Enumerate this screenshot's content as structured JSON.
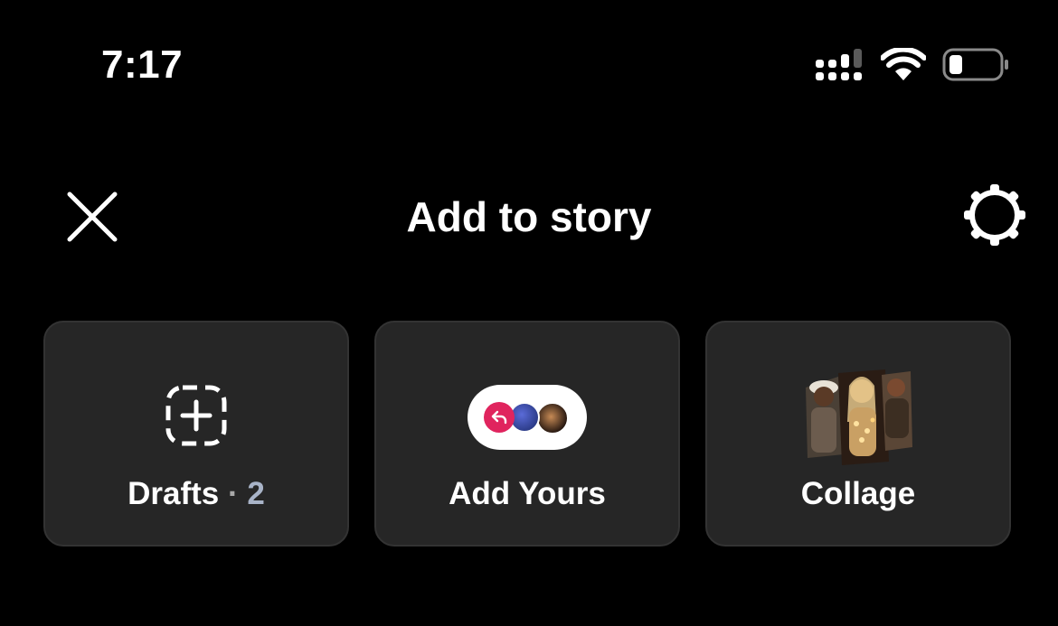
{
  "status_bar": {
    "time": "7:17"
  },
  "header": {
    "title": "Add to story"
  },
  "cards": {
    "drafts": {
      "label": "Drafts",
      "separator": "·",
      "count": "2"
    },
    "add_yours": {
      "label": "Add Yours"
    },
    "collage": {
      "label": "Collage"
    }
  },
  "colors": {
    "background": "#000000",
    "card_background": "#262626",
    "accent_pink": "#e0245e",
    "text_primary": "#ffffff",
    "text_secondary": "#a8b3c7"
  },
  "icons": {
    "close": "close-icon",
    "settings": "gear-icon",
    "drafts": "dashed-plus-icon",
    "add_yours": "reply-avatars-pill-icon",
    "collage": "collage-thumbnail"
  }
}
